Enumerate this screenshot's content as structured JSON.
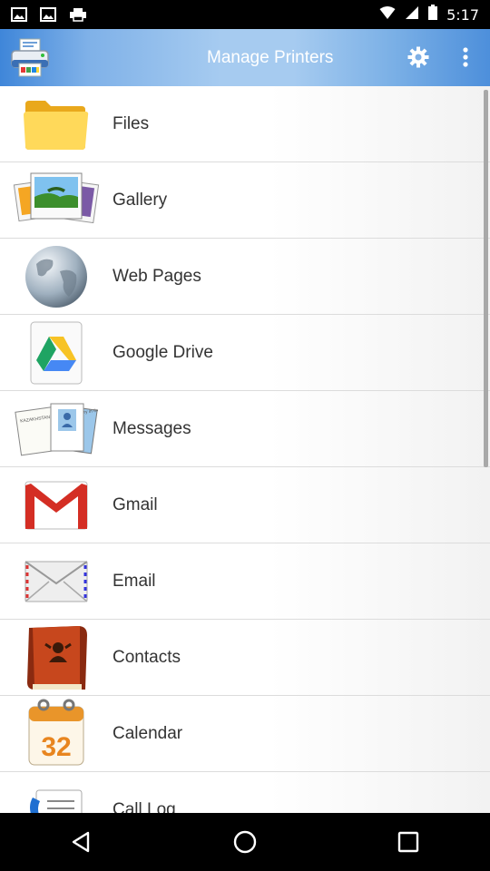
{
  "status_bar": {
    "time": "5:17"
  },
  "app_bar": {
    "title": "Manage Printers",
    "logo_icon": "printer-icon",
    "settings_icon": "gear-icon",
    "overflow_icon": "more-vert-icon",
    "accent": "#5a9be0"
  },
  "list": {
    "items": [
      {
        "label": "Files",
        "icon": "folder-icon"
      },
      {
        "label": "Gallery",
        "icon": "photos-icon"
      },
      {
        "label": "Web Pages",
        "icon": "globe-icon"
      },
      {
        "label": "Google Drive",
        "icon": "google-drive-icon"
      },
      {
        "label": "Messages",
        "icon": "messages-icon"
      },
      {
        "label": "Gmail",
        "icon": "gmail-icon"
      },
      {
        "label": "Email",
        "icon": "envelope-icon"
      },
      {
        "label": "Contacts",
        "icon": "contacts-book-icon"
      },
      {
        "label": "Calendar",
        "icon": "calendar-icon",
        "calendar_day": "32"
      },
      {
        "label": "Call Log",
        "icon": "call-log-icon"
      }
    ],
    "messages_icon_text": "KAZAKHSTAN is the best country in the world"
  },
  "nav_bar": {
    "back_icon": "back-icon",
    "home_icon": "home-icon",
    "recents_icon": "recents-icon"
  }
}
